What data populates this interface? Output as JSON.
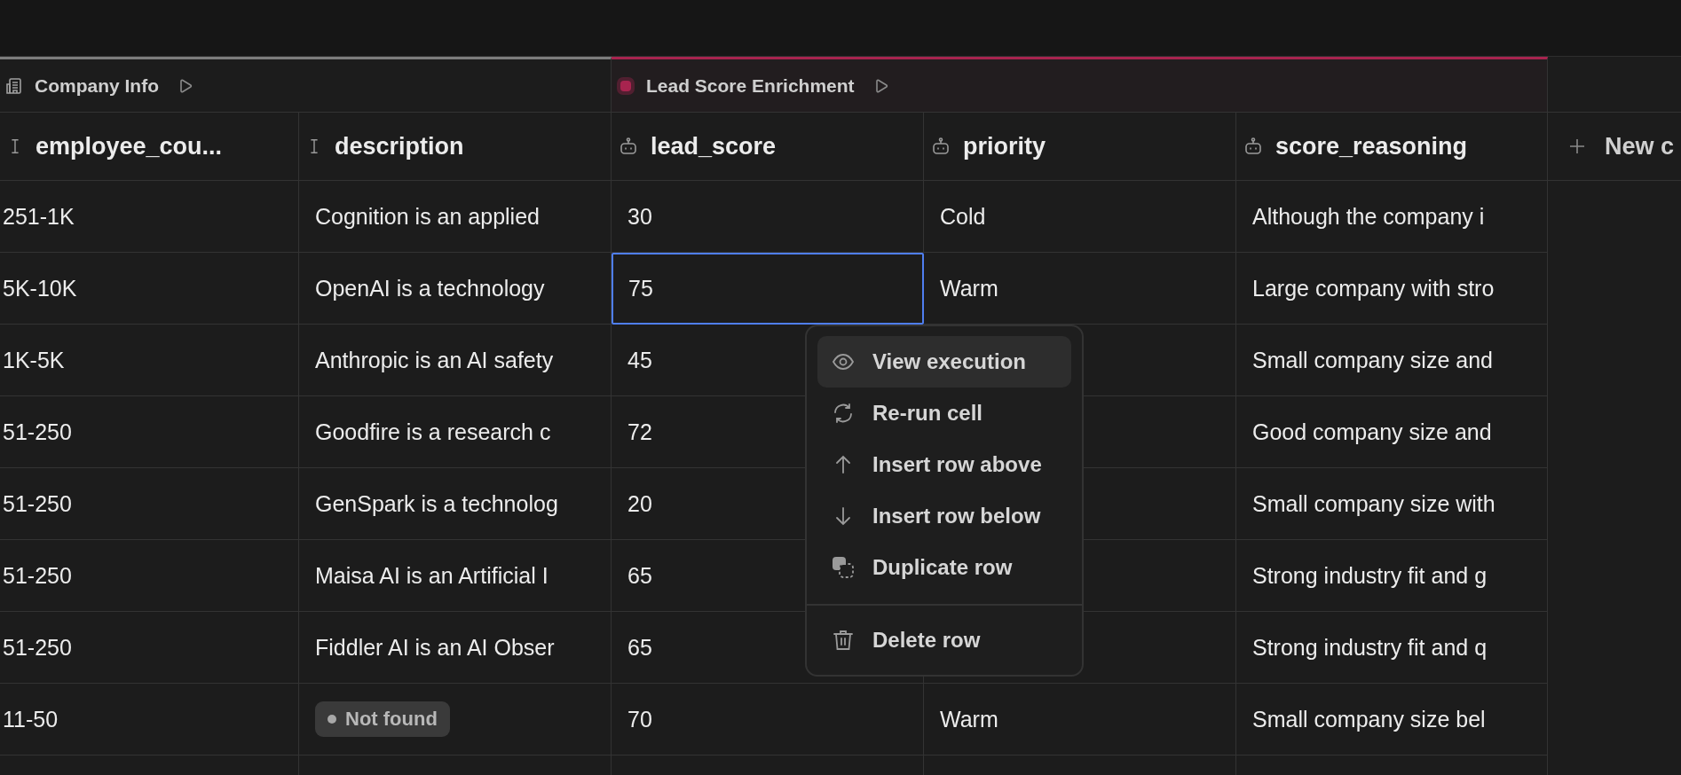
{
  "groups": [
    {
      "label": "Company Info",
      "kind": "building",
      "color": "#7d7d7d"
    },
    {
      "label": "Lead Score Enrichment",
      "kind": "dot",
      "color": "#a8244f"
    }
  ],
  "table": {
    "columns": [
      {
        "label": "employee_cou...",
        "kind": "text"
      },
      {
        "label": "description",
        "kind": "text"
      },
      {
        "label": "lead_score",
        "kind": "ai"
      },
      {
        "label": "priority",
        "kind": "ai"
      },
      {
        "label": "score_reasoning",
        "kind": "ai"
      },
      {
        "label": "New c",
        "kind": "add"
      }
    ],
    "rows": [
      {
        "cells": [
          {
            "kind": "text",
            "text": "251-1K",
            "selected": false
          },
          {
            "kind": "text",
            "text": "Cognition is an applied",
            "selected": false
          },
          {
            "kind": "text",
            "text": "30",
            "selected": false
          },
          {
            "kind": "text",
            "text": "Cold",
            "selected": false
          },
          {
            "kind": "text",
            "text": "Although the company i",
            "selected": false
          }
        ]
      },
      {
        "cells": [
          {
            "kind": "text",
            "text": "5K-10K",
            "selected": false
          },
          {
            "kind": "text",
            "text": "OpenAI is a technology",
            "selected": false
          },
          {
            "kind": "text",
            "text": "75",
            "selected": true
          },
          {
            "kind": "text",
            "text": "Warm",
            "selected": false
          },
          {
            "kind": "text",
            "text": "Large company with stro",
            "selected": false
          }
        ]
      },
      {
        "cells": [
          {
            "kind": "text",
            "text": "1K-5K",
            "selected": false
          },
          {
            "kind": "text",
            "text": "Anthropic is an AI safety",
            "selected": false
          },
          {
            "kind": "text",
            "text": "45",
            "selected": false
          },
          {
            "kind": "text",
            "selected": false
          },
          {
            "kind": "text",
            "text": "Small company size and",
            "selected": false
          }
        ]
      },
      {
        "cells": [
          {
            "kind": "text",
            "text": "51-250",
            "selected": false
          },
          {
            "kind": "text",
            "text": "Goodfire is a research c",
            "selected": false
          },
          {
            "kind": "text",
            "text": "72",
            "selected": false
          },
          {
            "kind": "text",
            "selected": false
          },
          {
            "kind": "text",
            "text": "Good company size and",
            "selected": false
          }
        ]
      },
      {
        "cells": [
          {
            "kind": "text",
            "text": "51-250",
            "selected": false
          },
          {
            "kind": "text",
            "text": "GenSpark is a technolog",
            "selected": false
          },
          {
            "kind": "text",
            "text": "20",
            "selected": false
          },
          {
            "kind": "text",
            "selected": false
          },
          {
            "kind": "text",
            "text": "Small company size with",
            "selected": false
          }
        ]
      },
      {
        "cells": [
          {
            "kind": "text",
            "text": "51-250",
            "selected": false
          },
          {
            "kind": "text",
            "text": "Maisa AI is an Artificial I",
            "selected": false
          },
          {
            "kind": "text",
            "text": "65",
            "selected": false
          },
          {
            "kind": "text",
            "selected": false
          },
          {
            "kind": "text",
            "text": "Strong industry fit and g",
            "selected": false
          }
        ]
      },
      {
        "cells": [
          {
            "kind": "text",
            "text": "51-250",
            "selected": false
          },
          {
            "kind": "text",
            "text": "Fiddler AI is an AI Obser",
            "selected": false
          },
          {
            "kind": "text",
            "text": "65",
            "selected": false
          },
          {
            "kind": "text",
            "selected": false
          },
          {
            "kind": "text",
            "text": "Strong industry fit and q",
            "selected": false
          }
        ]
      },
      {
        "cells": [
          {
            "kind": "text",
            "text": "11-50",
            "selected": false
          },
          {
            "kind": "badge",
            "text": "Not found",
            "selected": false
          },
          {
            "kind": "text",
            "text": "70",
            "selected": false
          },
          {
            "kind": "text",
            "text": "Warm",
            "selected": false
          },
          {
            "kind": "text",
            "text": "Small company size bel",
            "selected": false
          }
        ]
      }
    ]
  },
  "context_menu": {
    "items": [
      {
        "label": "View execution",
        "kind": "eye",
        "selected": true,
        "separated": false
      },
      {
        "label": "Re-run cell",
        "kind": "refresh",
        "selected": false,
        "separated": false
      },
      {
        "label": "Insert row above",
        "kind": "up",
        "selected": false,
        "separated": false
      },
      {
        "label": "Insert row below",
        "kind": "down",
        "selected": false,
        "separated": false
      },
      {
        "label": "Duplicate row",
        "kind": "duplicate",
        "selected": false,
        "separated": false
      },
      {
        "label": "Delete row",
        "kind": "trash",
        "selected": false,
        "separated": true
      }
    ]
  }
}
